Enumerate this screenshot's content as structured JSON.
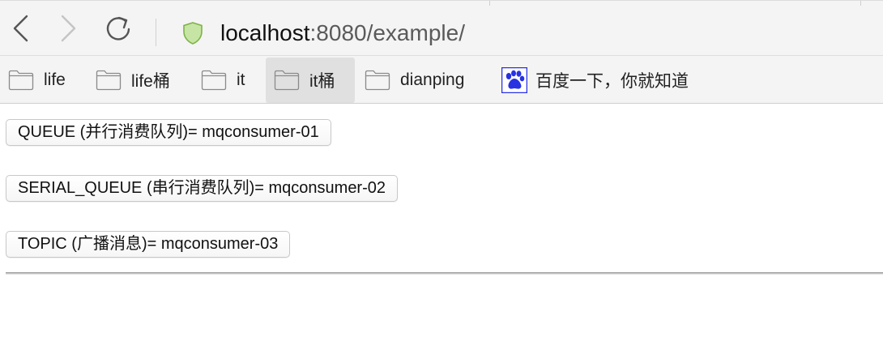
{
  "browser": {
    "url_host": "localhost",
    "url_rest": ":8080/example/"
  },
  "icons": {
    "back": "chevron-left-icon",
    "forward": "chevron-right-icon",
    "reload": "reload-icon",
    "security": "shield-icon",
    "folder": "folder-icon",
    "baidu": "baidu-paw-icon"
  },
  "bookmarks": [
    {
      "label": "life",
      "icon": "folder-icon",
      "active": false
    },
    {
      "label": "life桶",
      "icon": "folder-icon",
      "active": false
    },
    {
      "label": "it",
      "icon": "folder-icon",
      "active": false
    },
    {
      "label": "it桶",
      "icon": "folder-icon",
      "active": true
    },
    {
      "label": "dianping",
      "icon": "folder-icon",
      "active": false
    },
    {
      "label": "百度一下，你就知道",
      "icon": "baidu-paw-icon",
      "active": false
    }
  ],
  "queues": [
    {
      "label": "QUEUE (并行消费队列)= mqconsumer-01"
    },
    {
      "label": "SERIAL_QUEUE (串行消费队列)= mqconsumer-02"
    },
    {
      "label": "TOPIC (广播消息)= mqconsumer-03"
    }
  ],
  "colors": {
    "shield": "#c6e5a4",
    "shield_stroke": "#7fb24a",
    "baidu_blue": "#2932e1",
    "toolbar_bg": "#f4f4f4"
  }
}
